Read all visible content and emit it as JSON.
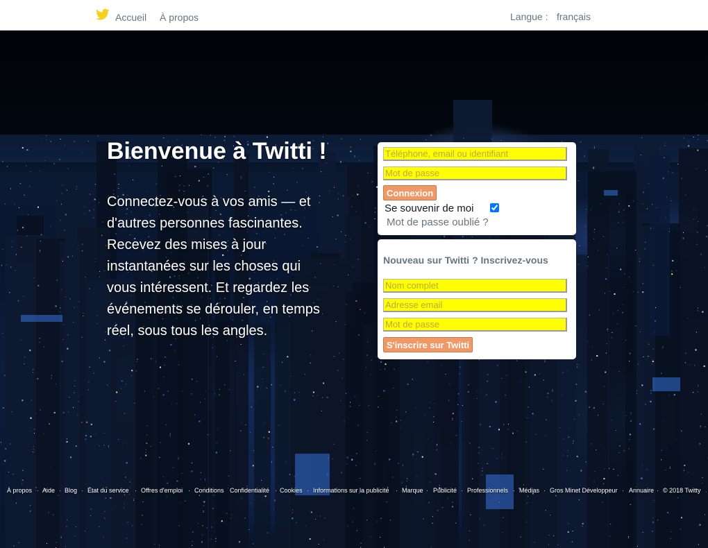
{
  "header": {
    "nav": [
      {
        "label": "Accueil"
      },
      {
        "label": "À propos"
      }
    ],
    "language_label": "Langue :",
    "language_value": "français"
  },
  "welcome": {
    "title": "Bienvenue à Twitti !",
    "text": "Connectez-vous à vos amis — et d'autres personnes fascinantes. Recevez des mises à jour instantanées sur les choses qui vous intéressent. Et regardez les événements se dérouler, en temps réel, sous tous les angles."
  },
  "login": {
    "username_placeholder": "Téléphone, email ou identifiant",
    "password_placeholder": "Mot de passe",
    "submit_label": "Connexion",
    "remember_label": "Se souvenir de moi",
    "remember_checked": true,
    "forgot_label": "Mot de passe oublié ?"
  },
  "signup": {
    "title": "Nouveau sur Twitti ? Inscrivez-vous",
    "name_placeholder": "Nom complet",
    "email_placeholder": "Adresse email",
    "password_placeholder": "Mot de passe",
    "submit_label": "S'inscrire sur Twitti"
  },
  "footer": {
    "links": [
      "À propos",
      "Aide",
      "Blog",
      "État du service",
      "Offres d'emploi",
      "Conditions",
      "Confidentialité",
      "Cookies",
      "Informations sur la publicité",
      "Marque",
      "Publicité",
      "Professionnels",
      "Médias",
      "Gros Minet Développeur",
      "Annuaire",
      "© 2018 Twitty"
    ]
  },
  "colors": {
    "input_bg": "#ffff00",
    "button_bg": "#f09866",
    "bird": "#f5d020"
  },
  "icons": {
    "logo": "bird-icon"
  }
}
